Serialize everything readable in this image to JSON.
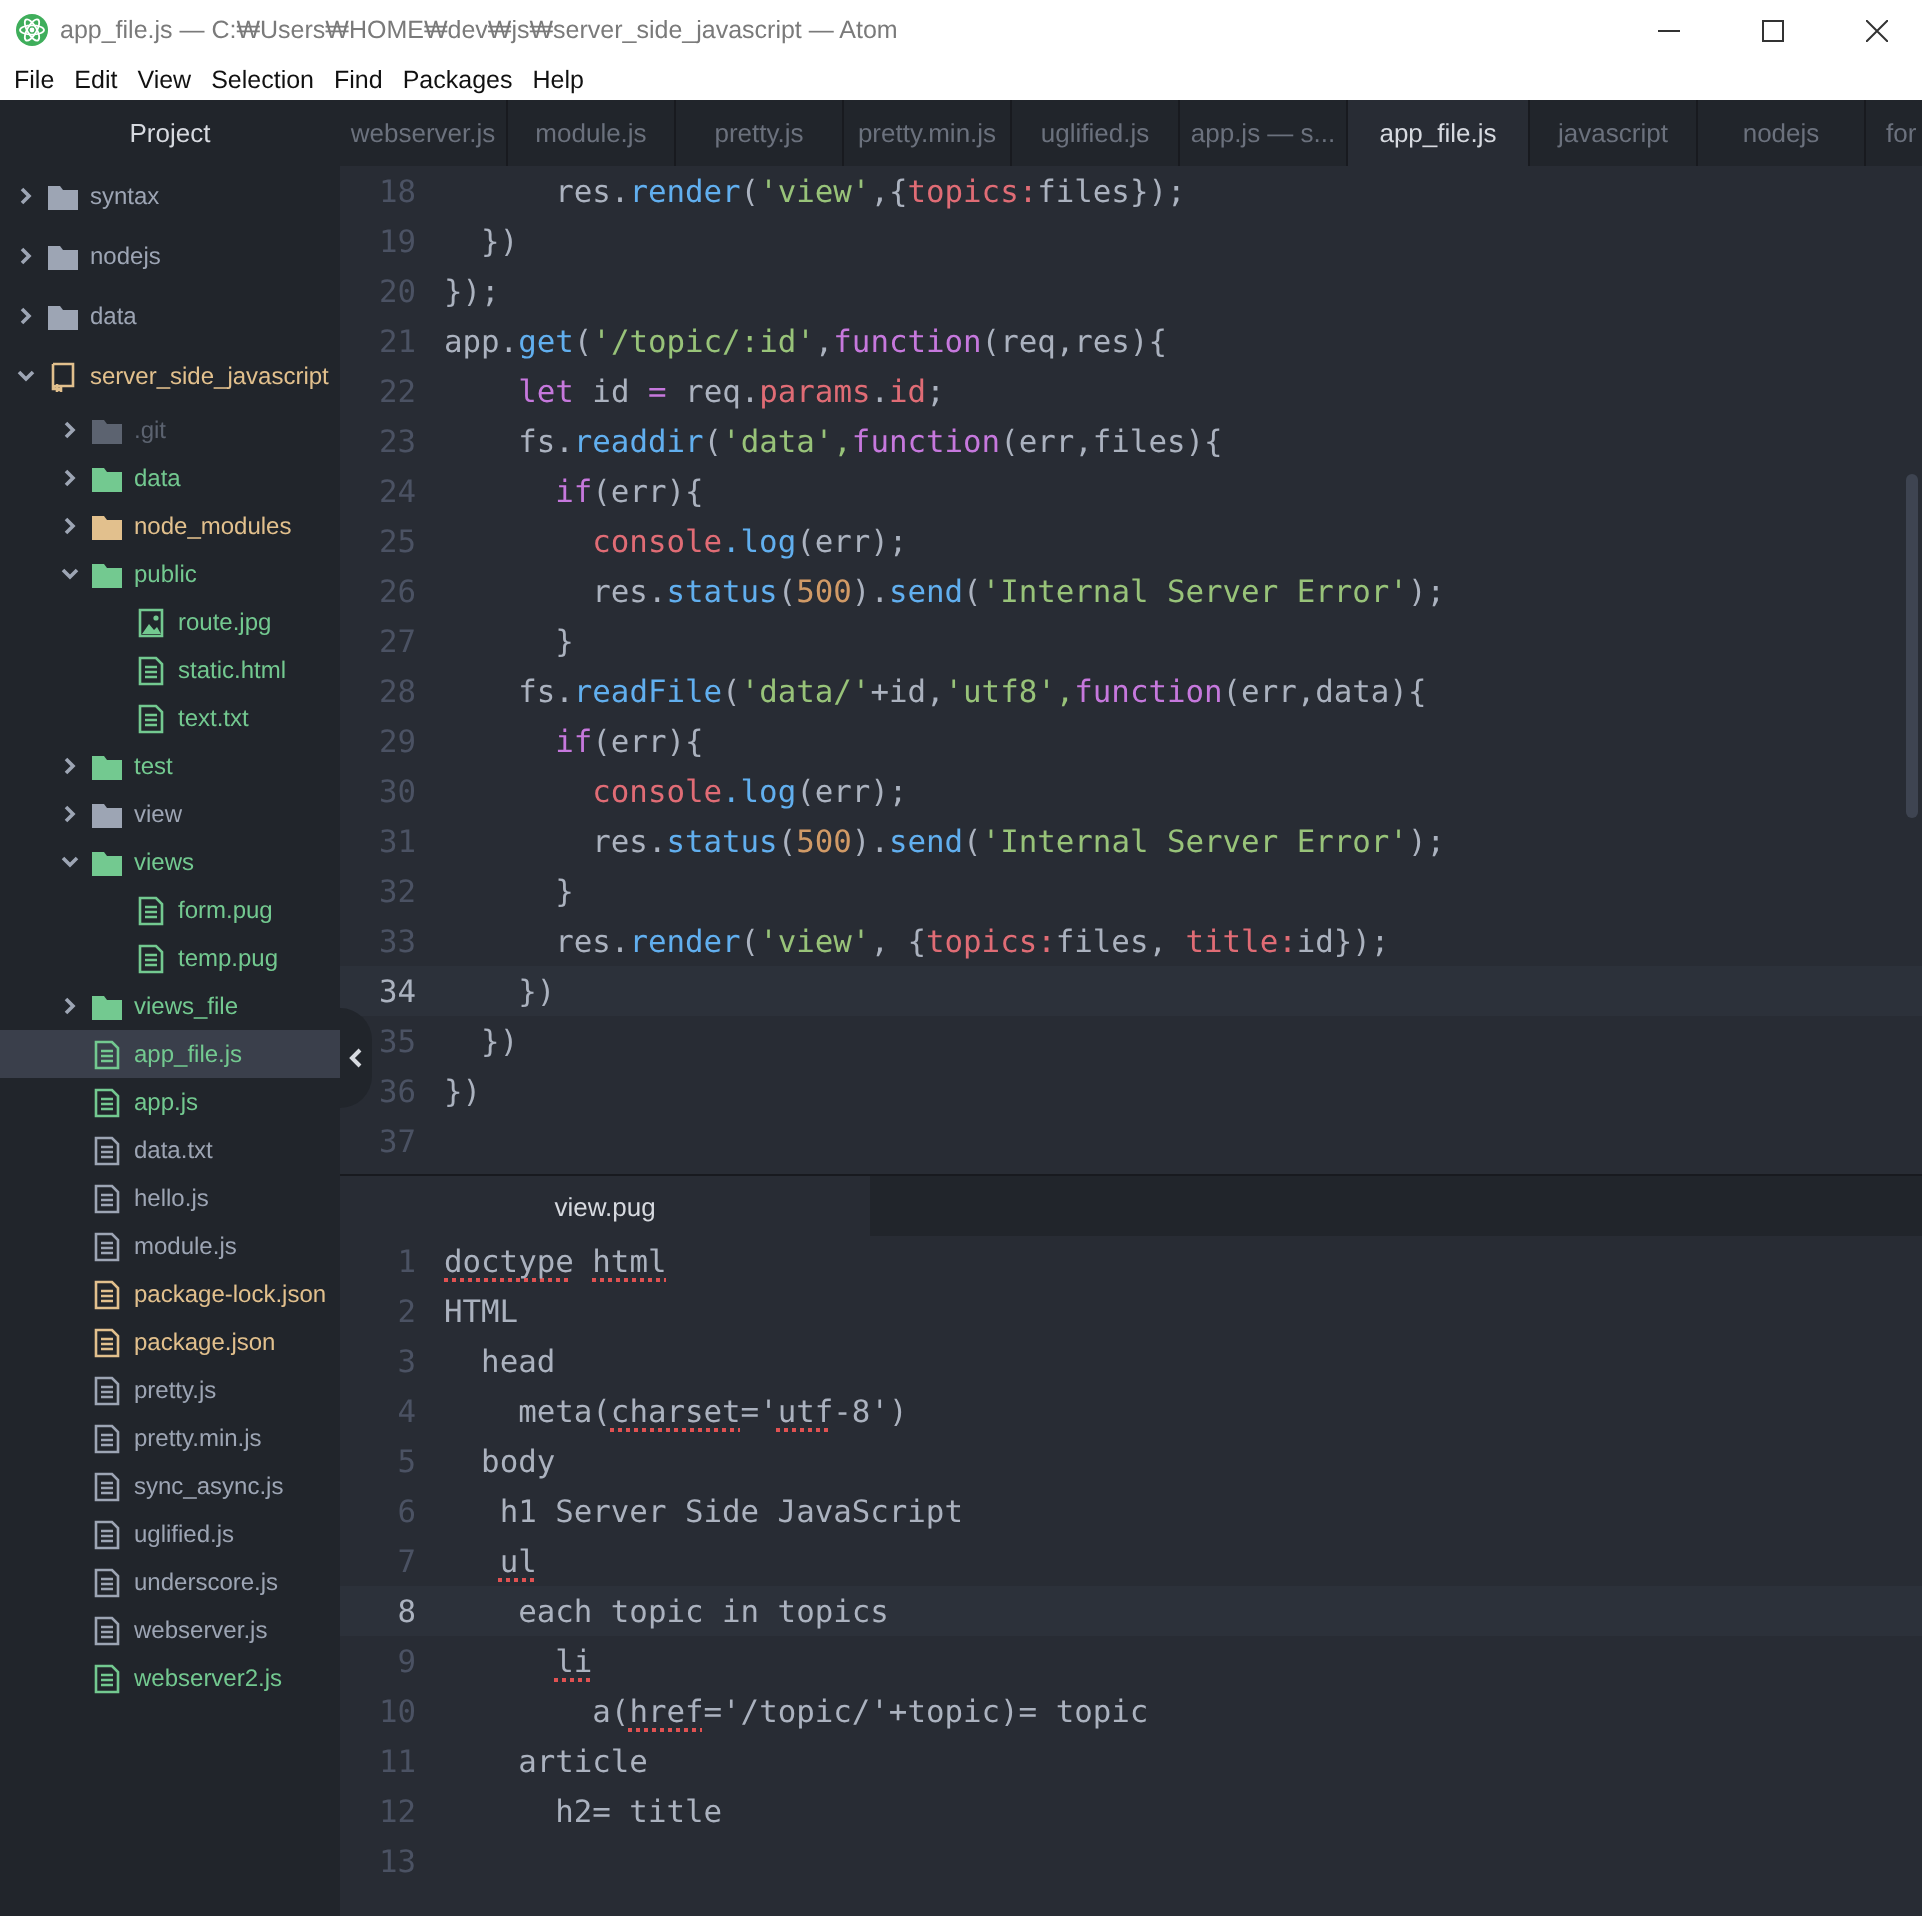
{
  "window": {
    "title": "app_file.js — C:₩Users₩HOME₩dev₩js₩server_side_javascript — Atom"
  },
  "menu": [
    "File",
    "Edit",
    "View",
    "Selection",
    "Find",
    "Packages",
    "Help"
  ],
  "sidebar": {
    "title": "Project",
    "items": [
      {
        "name": "syntax",
        "kind": "folder",
        "expanded": false,
        "selected": false,
        "color": "#9da5b4"
      },
      {
        "name": "nodejs",
        "kind": "folder",
        "expanded": false,
        "selected": false,
        "color": "#9da5b4"
      },
      {
        "name": "data",
        "kind": "folder",
        "expanded": false,
        "selected": false,
        "color": "#9da5b4"
      },
      {
        "name": "server_side_javascript",
        "kind": "repo",
        "expanded": true,
        "selected": false,
        "color": "#e2c08d",
        "children": [
          {
            "name": ".git",
            "kind": "folder",
            "expanded": false,
            "selected": false,
            "color": "#5c6370"
          },
          {
            "name": "data",
            "kind": "folder",
            "expanded": false,
            "selected": false,
            "color": "#73c990"
          },
          {
            "name": "node_modules",
            "kind": "folder",
            "expanded": false,
            "selected": false,
            "color": "#e2c08d"
          },
          {
            "name": "public",
            "kind": "folder",
            "expanded": true,
            "selected": false,
            "color": "#73c990",
            "children": [
              {
                "name": "route.jpg",
                "kind": "image",
                "selected": false,
                "color": "#73c990"
              },
              {
                "name": "static.html",
                "kind": "file",
                "selected": false,
                "color": "#73c990"
              },
              {
                "name": "text.txt",
                "kind": "file",
                "selected": false,
                "color": "#73c990"
              }
            ]
          },
          {
            "name": "test",
            "kind": "folder",
            "expanded": false,
            "selected": false,
            "color": "#73c990"
          },
          {
            "name": "view",
            "kind": "folder",
            "expanded": false,
            "selected": false,
            "color": "#9da5b4"
          },
          {
            "name": "views",
            "kind": "folder",
            "expanded": true,
            "selected": false,
            "color": "#73c990",
            "children": [
              {
                "name": "form.pug",
                "kind": "file",
                "selected": false,
                "color": "#73c990"
              },
              {
                "name": "temp.pug",
                "kind": "file",
                "selected": false,
                "color": "#73c990"
              }
            ]
          },
          {
            "name": "views_file",
            "kind": "folder",
            "expanded": false,
            "selected": false,
            "color": "#73c990"
          },
          {
            "name": "app_file.js",
            "kind": "file",
            "selected": true,
            "color": "#73c990"
          },
          {
            "name": "app.js",
            "kind": "file",
            "selected": false,
            "color": "#73c990"
          },
          {
            "name": "data.txt",
            "kind": "file",
            "selected": false,
            "color": "#9da5b4"
          },
          {
            "name": "hello.js",
            "kind": "file",
            "selected": false,
            "color": "#9da5b4"
          },
          {
            "name": "module.js",
            "kind": "file",
            "selected": false,
            "color": "#9da5b4"
          },
          {
            "name": "package-lock.json",
            "kind": "file",
            "selected": false,
            "color": "#e2c08d"
          },
          {
            "name": "package.json",
            "kind": "file",
            "selected": false,
            "color": "#e2c08d"
          },
          {
            "name": "pretty.js",
            "kind": "file",
            "selected": false,
            "color": "#9da5b4"
          },
          {
            "name": "pretty.min.js",
            "kind": "file",
            "selected": false,
            "color": "#9da5b4"
          },
          {
            "name": "sync_async.js",
            "kind": "file",
            "selected": false,
            "color": "#9da5b4"
          },
          {
            "name": "uglified.js",
            "kind": "file",
            "selected": false,
            "color": "#9da5b4"
          },
          {
            "name": "underscore.js",
            "kind": "file",
            "selected": false,
            "color": "#9da5b4"
          },
          {
            "name": "webserver.js",
            "kind": "file",
            "selected": false,
            "color": "#9da5b4"
          },
          {
            "name": "webserver2.js",
            "kind": "file",
            "selected": false,
            "color": "#73c990"
          }
        ]
      }
    ]
  },
  "editor": {
    "tabs": [
      {
        "label": "webserver.js",
        "selected": false
      },
      {
        "label": "module.js",
        "selected": false
      },
      {
        "label": "pretty.js",
        "selected": false
      },
      {
        "label": "pretty.min.js",
        "selected": false
      },
      {
        "label": "uglified.js",
        "selected": false
      },
      {
        "label": "app.js — s...",
        "selected": false
      },
      {
        "label": "app_file.js",
        "selected": true
      },
      {
        "label": "javascript",
        "selected": false
      },
      {
        "label": "nodejs",
        "selected": false
      },
      {
        "label": "for",
        "selected": false
      }
    ],
    "lines": [
      {
        "number": "18",
        "current": false,
        "tokens": [
          {
            "kind": "plain",
            "text": "      res."
          },
          {
            "kind": "fn",
            "text": "render"
          },
          {
            "kind": "plain",
            "text": "("
          },
          {
            "kind": "str",
            "text": "'view'"
          },
          {
            "kind": "plain",
            "text": ",{"
          },
          {
            "kind": "prop",
            "text": "topics:"
          },
          {
            "kind": "plain",
            "text": "files});"
          }
        ]
      },
      {
        "number": "19",
        "current": false,
        "tokens": [
          {
            "kind": "plain",
            "text": "  })"
          }
        ]
      },
      {
        "number": "20",
        "current": false,
        "tokens": [
          {
            "kind": "plain",
            "text": "});"
          }
        ]
      },
      {
        "number": "21",
        "current": false,
        "tokens": [
          {
            "kind": "plain",
            "text": "app."
          },
          {
            "kind": "fn",
            "text": "get"
          },
          {
            "kind": "plain",
            "text": "("
          },
          {
            "kind": "str",
            "text": "'/topic/:id'"
          },
          {
            "kind": "plain",
            "text": ","
          },
          {
            "kind": "kw",
            "text": "function"
          },
          {
            "kind": "plain",
            "text": "(req,res){"
          }
        ]
      },
      {
        "number": "22",
        "current": false,
        "tokens": [
          {
            "kind": "kw",
            "text": "    let"
          },
          {
            "kind": "plain",
            "text": " id "
          },
          {
            "kind": "kw",
            "text": "="
          },
          {
            "kind": "plain",
            "text": " req."
          },
          {
            "kind": "prop",
            "text": "params"
          },
          {
            "kind": "plain",
            "text": "."
          },
          {
            "kind": "prop",
            "text": "id"
          },
          {
            "kind": "plain",
            "text": ";"
          }
        ]
      },
      {
        "number": "23",
        "current": false,
        "tokens": [
          {
            "kind": "plain",
            "text": "    fs."
          },
          {
            "kind": "fn",
            "text": "readdir"
          },
          {
            "kind": "plain",
            "text": "("
          },
          {
            "kind": "str",
            "text": "'data',"
          },
          {
            "kind": "kw",
            "text": "function"
          },
          {
            "kind": "plain",
            "text": "(err,files){"
          }
        ]
      },
      {
        "number": "24",
        "current": false,
        "tokens": [
          {
            "kind": "kw",
            "text": "      if"
          },
          {
            "kind": "plain",
            "text": "(err){"
          }
        ]
      },
      {
        "number": "25",
        "current": false,
        "tokens": [
          {
            "kind": "prop",
            "text": "        console"
          },
          {
            "kind": "fn",
            "text": ".log"
          },
          {
            "kind": "plain",
            "text": "(err);"
          }
        ]
      },
      {
        "number": "26",
        "current": false,
        "tokens": [
          {
            "kind": "plain",
            "text": "        res."
          },
          {
            "kind": "fn",
            "text": "status"
          },
          {
            "kind": "plain",
            "text": "("
          },
          {
            "kind": "num",
            "text": "500"
          },
          {
            "kind": "plain",
            "text": ")."
          },
          {
            "kind": "fn",
            "text": "send"
          },
          {
            "kind": "plain",
            "text": "("
          },
          {
            "kind": "str",
            "text": "'Internal Server Error'"
          },
          {
            "kind": "plain",
            "text": ");"
          }
        ]
      },
      {
        "number": "27",
        "current": false,
        "tokens": [
          {
            "kind": "plain",
            "text": "      }"
          }
        ]
      },
      {
        "number": "28",
        "current": false,
        "tokens": [
          {
            "kind": "plain",
            "text": "    fs."
          },
          {
            "kind": "fn",
            "text": "readFile"
          },
          {
            "kind": "plain",
            "text": "("
          },
          {
            "kind": "str",
            "text": "'data/'"
          },
          {
            "kind": "plain",
            "text": "+id,"
          },
          {
            "kind": "str",
            "text": "'utf8',"
          },
          {
            "kind": "kw",
            "text": "function"
          },
          {
            "kind": "plain",
            "text": "(err,data){"
          }
        ]
      },
      {
        "number": "29",
        "current": false,
        "tokens": [
          {
            "kind": "kw",
            "text": "      if"
          },
          {
            "kind": "plain",
            "text": "(err){"
          }
        ]
      },
      {
        "number": "30",
        "current": false,
        "tokens": [
          {
            "kind": "prop",
            "text": "        console"
          },
          {
            "kind": "fn",
            "text": ".log"
          },
          {
            "kind": "plain",
            "text": "(err);"
          }
        ]
      },
      {
        "number": "31",
        "current": false,
        "tokens": [
          {
            "kind": "plain",
            "text": "        res."
          },
          {
            "kind": "fn",
            "text": "status"
          },
          {
            "kind": "plain",
            "text": "("
          },
          {
            "kind": "num",
            "text": "500"
          },
          {
            "kind": "plain",
            "text": ")."
          },
          {
            "kind": "fn",
            "text": "send"
          },
          {
            "kind": "plain",
            "text": "("
          },
          {
            "kind": "str",
            "text": "'Internal Server Error'"
          },
          {
            "kind": "plain",
            "text": ");"
          }
        ]
      },
      {
        "number": "32",
        "current": false,
        "tokens": [
          {
            "kind": "plain",
            "text": "      }"
          }
        ]
      },
      {
        "number": "33",
        "current": false,
        "tokens": [
          {
            "kind": "plain",
            "text": "      res."
          },
          {
            "kind": "fn",
            "text": "render"
          },
          {
            "kind": "plain",
            "text": "("
          },
          {
            "kind": "str",
            "text": "'view'"
          },
          {
            "kind": "plain",
            "text": ", {"
          },
          {
            "kind": "prop",
            "text": "topics:"
          },
          {
            "kind": "plain",
            "text": "files, "
          },
          {
            "kind": "prop",
            "text": "title:"
          },
          {
            "kind": "plain",
            "text": "id});"
          }
        ]
      },
      {
        "number": "34",
        "current": true,
        "tokens": [
          {
            "kind": "plain",
            "text": "    })"
          }
        ]
      },
      {
        "number": "35",
        "current": false,
        "tokens": [
          {
            "kind": "plain",
            "text": "  })"
          }
        ]
      },
      {
        "number": "36",
        "current": false,
        "tokens": [
          {
            "kind": "plain",
            "text": "})"
          }
        ]
      },
      {
        "number": "37",
        "current": false
      }
    ]
  },
  "bottom_pane": {
    "tabs": [
      {
        "label": "view.pug",
        "selected": true
      }
    ],
    "lines": [
      {
        "number": "1",
        "current": false,
        "tokens": [
          {
            "kind": "misspelled",
            "text": "doctype"
          },
          {
            "kind": "misspelled",
            "text": " html"
          }
        ]
      },
      {
        "number": "2",
        "current": false,
        "tokens": [
          {
            "kind": "plain",
            "text": "HTML"
          }
        ]
      },
      {
        "number": "3",
        "current": false,
        "tokens": [
          {
            "kind": "plain",
            "text": "  head"
          }
        ]
      },
      {
        "number": "4",
        "current": false,
        "tokens": [
          {
            "kind": "plain",
            "text": "    meta("
          },
          {
            "kind": "misspelled",
            "text": "charset"
          },
          {
            "kind": "plain",
            "text": "='"
          },
          {
            "kind": "misspelled",
            "text": "utf"
          },
          {
            "kind": "plain",
            "text": "-8')"
          }
        ]
      },
      {
        "number": "5",
        "current": false,
        "tokens": [
          {
            "kind": "plain",
            "text": "  body"
          }
        ]
      },
      {
        "number": "6",
        "current": false,
        "tokens": [
          {
            "kind": "plain",
            "text": "   h1 Server Side JavaScript"
          }
        ]
      },
      {
        "number": "7",
        "current": false,
        "tokens": [
          {
            "kind": "misspelled",
            "text": "   ul"
          }
        ]
      },
      {
        "number": "8",
        "current": true,
        "tokens": [
          {
            "kind": "plain",
            "text": "    each topic in topics"
          }
        ]
      },
      {
        "number": "9",
        "current": false,
        "tokens": [
          {
            "kind": "misspelled",
            "text": "      li"
          }
        ]
      },
      {
        "number": "10",
        "current": false,
        "tokens": [
          {
            "kind": "plain",
            "text": "        a("
          },
          {
            "kind": "misspelled",
            "text": "href"
          },
          {
            "kind": "plain",
            "text": "='/topic/'+topic)= topic"
          }
        ]
      },
      {
        "number": "11",
        "current": false,
        "tokens": [
          {
            "kind": "plain",
            "text": "    article"
          }
        ]
      },
      {
        "number": "12",
        "current": false,
        "tokens": [
          {
            "kind": "plain",
            "text": "      h2= title"
          }
        ]
      },
      {
        "number": "13",
        "current": false
      }
    ]
  }
}
